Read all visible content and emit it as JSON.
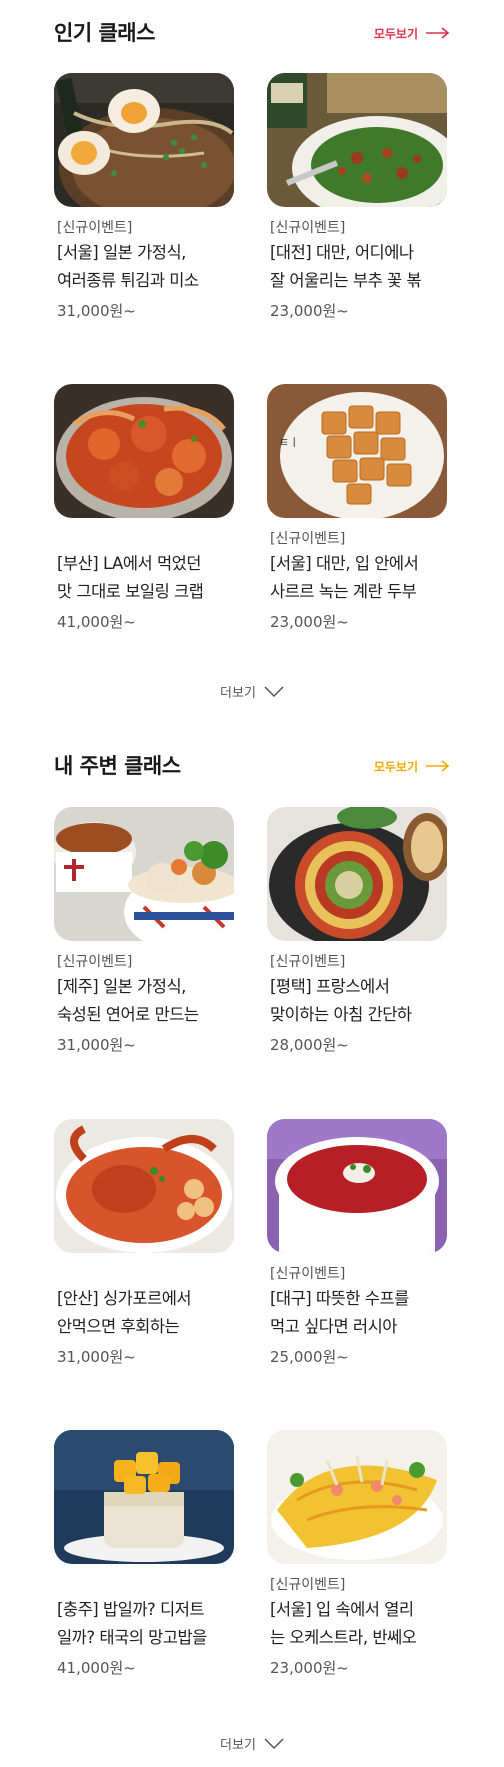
{
  "popular": {
    "title": "인기 클래스",
    "see_all": "모두보기",
    "accent_color": "#e0304a",
    "more": "더보기",
    "cards": [
      {
        "badge": "[신규이벤트]",
        "title": "[서울] 일본 가정식,\n여러종류 튀김과 미소",
        "price": "31,000원~",
        "image": "ramen-with-eggs"
      },
      {
        "badge": "[신규이벤트]",
        "title": "[대전] 대만, 어디에나\n잘 어울리는 부추 꽃 볶",
        "price": "23,000원~",
        "image": "stir-fried-chive-flowers"
      },
      {
        "badge": "",
        "title": "[부산] LA에서 먹었던\n맛 그대로 보일링 크랩",
        "price": "41,000원~",
        "image": "boiling-crab"
      },
      {
        "badge": "[신규이벤트]",
        "title": "[서울] 대만, 입 안에서\n사르르 녹는 계란 두부",
        "price": "23,000원~",
        "image": "egg-tofu"
      }
    ]
  },
  "nearby": {
    "title": "내 주변 클래스",
    "see_all": "모두보기",
    "accent_color": "#f5a800",
    "more": "더보기",
    "cards": [
      {
        "badge": "[신규이벤트]",
        "title": "[제주] 일본 가정식,\n숙성된 연어로 만드는",
        "price": "31,000원~",
        "image": "japanese-bowls"
      },
      {
        "badge": "[신규이벤트]",
        "title": "[평택] 프랑스에서\n맞이하는 아침 간단하",
        "price": "28,000원~",
        "image": "ratatouille"
      },
      {
        "badge": "",
        "title": "[안산] 싱가포르에서\n안먹으면 후회하는",
        "price": "31,000원~",
        "image": "chili-crab"
      },
      {
        "badge": "[신규이벤트]",
        "title": "[대구] 따뜻한 수프를\n먹고 싶다면 러시아",
        "price": "25,000원~",
        "image": "borscht-soup"
      },
      {
        "badge": "",
        "title": "[충주] 밥일까? 디저트\n일까? 태국의 망고밥을",
        "price": "41,000원~",
        "image": "mango-sticky-rice"
      },
      {
        "badge": "[신규이벤트]",
        "title": "[서울] 입 속에서 열리\n는 오케스트라, 반쎄오",
        "price": "23,000원~",
        "image": "banh-xeo"
      }
    ]
  }
}
